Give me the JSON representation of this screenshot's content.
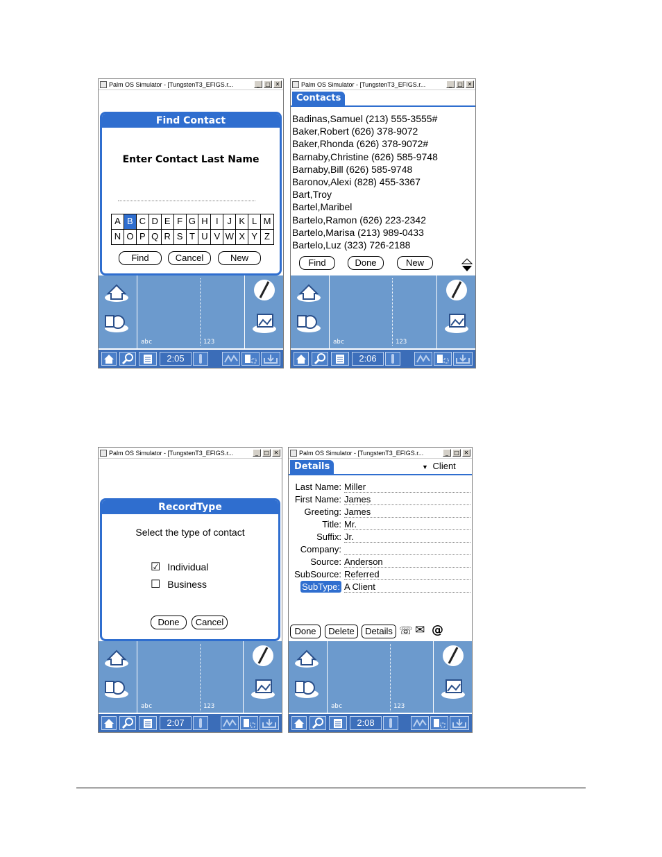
{
  "window_title": "Palm OS Simulator - [TungstenT3_EFIGS.r...",
  "window_buttons": {
    "minimize": "_",
    "maximize": "□",
    "close": "✕"
  },
  "graffiti": {
    "abc_label": "abc",
    "num_label": "123"
  },
  "find_contact": {
    "title": "Find Contact",
    "prompt": "Enter Contact Last Name",
    "letters_row1": [
      "A",
      "B",
      "C",
      "D",
      "E",
      "F",
      "G",
      "H",
      "I",
      "J",
      "K",
      "L",
      "M"
    ],
    "letters_row2": [
      "N",
      "O",
      "P",
      "Q",
      "R",
      "S",
      "T",
      "U",
      "V",
      "W",
      "X",
      "Y",
      "Z"
    ],
    "selected_letter": "B",
    "buttons": {
      "find": "Find",
      "cancel": "Cancel",
      "new": "New"
    },
    "time": "2:05"
  },
  "contacts": {
    "title": "Contacts",
    "rows": [
      "Badinas,Samuel (213) 555-3555#",
      "Baker,Robert (626) 378-9072",
      "Baker,Rhonda (626) 378-9072#",
      "Barnaby,Christine (626) 585-9748",
      "Barnaby,Bill (626) 585-9748",
      "Baronov,Alexi (828) 455-3367",
      "Bart,Troy",
      "Bartel,Maribel",
      "Bartelo,Ramon (626) 223-2342",
      "Bartelo,Marisa (213) 989-0433",
      "Bartelo,Luz (323) 726-2188"
    ],
    "buttons": {
      "find": "Find",
      "done": "Done",
      "new": "New"
    },
    "time": "2:06"
  },
  "record_type": {
    "title": "RecordType",
    "prompt": "Select the type of contact",
    "options": [
      {
        "label": "Individual",
        "checked": true
      },
      {
        "label": "Business",
        "checked": false
      }
    ],
    "check_marks": {
      "checked": "☑",
      "unchecked": "☐"
    },
    "buttons": {
      "done": "Done",
      "cancel": "Cancel"
    },
    "time": "2:07"
  },
  "details": {
    "title": "Details",
    "category_arrow": "▼",
    "category": "Client",
    "fields": [
      {
        "label": "Last Name:",
        "value": "Miller"
      },
      {
        "label": "First Name:",
        "value": "James"
      },
      {
        "label": "Greeting:",
        "value": "James"
      },
      {
        "label": "Title:",
        "value": "Mr."
      },
      {
        "label": "Suffix:",
        "value": "Jr."
      },
      {
        "label": "Company:",
        "value": ""
      },
      {
        "label": "Source:",
        "value": "Anderson"
      },
      {
        "label": "SubSource:",
        "value": "Referred"
      },
      {
        "label": "SubType:",
        "value": "A Client",
        "highlighted": true
      }
    ],
    "buttons": {
      "done": "Done",
      "delete": "Delete",
      "details": "Details"
    },
    "extra_icons": {
      "phone": "☏",
      "mail": "✉",
      "at": "@"
    },
    "time": "2:08"
  },
  "colors": {
    "palm_blue": "#2f6ecf",
    "graffiti_blue": "#6c9acd",
    "statusbar_blue": "#3b6db8"
  }
}
